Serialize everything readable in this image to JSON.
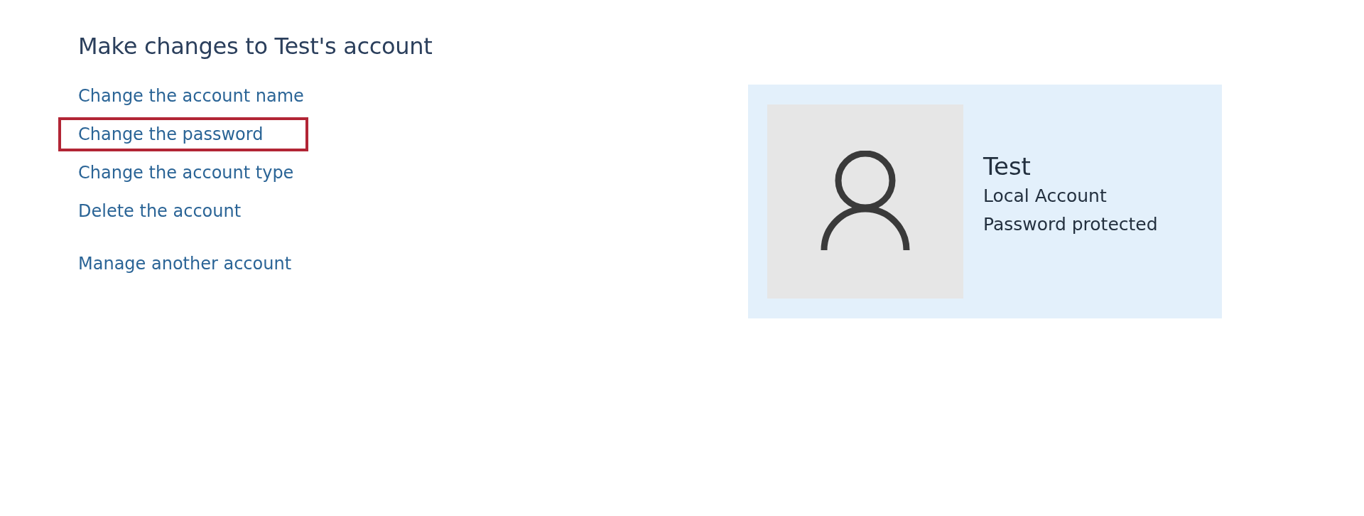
{
  "heading": "Make changes to Test's account",
  "actions": [
    {
      "label": "Change the account name",
      "highlighted": false
    },
    {
      "label": "Change the password",
      "highlighted": true
    },
    {
      "label": "Change the account type",
      "highlighted": false
    },
    {
      "label": "Delete the account",
      "highlighted": false
    }
  ],
  "other_actions": [
    {
      "label": "Manage another account",
      "highlighted": false
    }
  ],
  "account": {
    "name": "Test",
    "type": "Local Account",
    "status": "Password protected"
  }
}
